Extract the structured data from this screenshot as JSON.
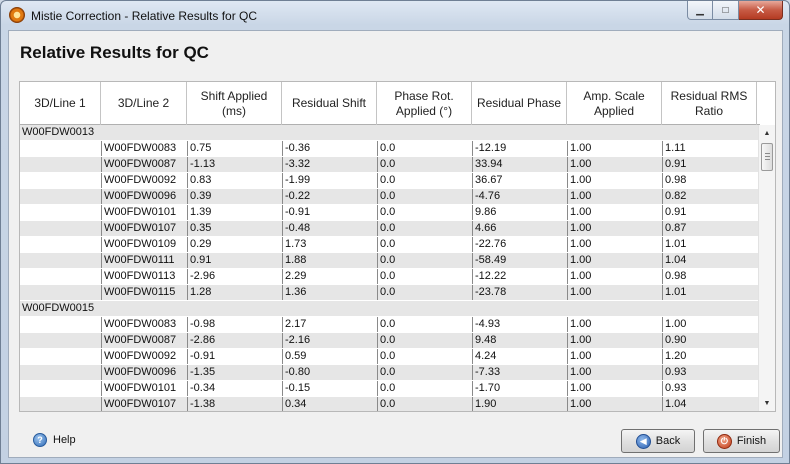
{
  "window": {
    "title": "Mistie Correction - Relative Results for QC",
    "minimize_glyph": "▁",
    "maximize_glyph": "□",
    "close_glyph": "✕"
  },
  "page": {
    "title": "Relative Results for QC"
  },
  "table": {
    "columns": [
      {
        "label": "3D/Line 1",
        "width": 81
      },
      {
        "label": "3D/Line 2",
        "width": 86
      },
      {
        "label": "Shift Applied (ms)",
        "width": 95
      },
      {
        "label": "Residual Shift",
        "width": 95
      },
      {
        "label": "Phase Rot. Applied (°)",
        "width": 95
      },
      {
        "label": "Residual Phase",
        "width": 95
      },
      {
        "label": "Amp. Scale Applied",
        "width": 95
      },
      {
        "label": "Residual RMS Ratio",
        "width": 95
      }
    ],
    "groups": [
      {
        "name": "W00FDW0013",
        "rows": [
          [
            "W00FDW0083",
            "0.75",
            "-0.36",
            "0.0",
            "-12.19",
            "1.00",
            "1.11"
          ],
          [
            "W00FDW0087",
            "-1.13",
            "-3.32",
            "0.0",
            "33.94",
            "1.00",
            "0.91"
          ],
          [
            "W00FDW0092",
            "0.83",
            "-1.99",
            "0.0",
            "36.67",
            "1.00",
            "0.98"
          ],
          [
            "W00FDW0096",
            "0.39",
            "-0.22",
            "0.0",
            "-4.76",
            "1.00",
            "0.82"
          ],
          [
            "W00FDW0101",
            "1.39",
            "-0.91",
            "0.0",
            "9.86",
            "1.00",
            "0.91"
          ],
          [
            "W00FDW0107",
            "0.35",
            "-0.48",
            "0.0",
            "4.66",
            "1.00",
            "0.87"
          ],
          [
            "W00FDW0109",
            "0.29",
            "1.73",
            "0.0",
            "-22.76",
            "1.00",
            "1.01"
          ],
          [
            "W00FDW0111",
            "0.91",
            "1.88",
            "0.0",
            "-58.49",
            "1.00",
            "1.04"
          ],
          [
            "W00FDW0113",
            "-2.96",
            "2.29",
            "0.0",
            "-12.22",
            "1.00",
            "0.98"
          ],
          [
            "W00FDW0115",
            "1.28",
            "1.36",
            "0.0",
            "-23.78",
            "1.00",
            "1.01"
          ]
        ]
      },
      {
        "name": "W00FDW0015",
        "rows": [
          [
            "W00FDW0083",
            "-0.98",
            "2.17",
            "0.0",
            "-4.93",
            "1.00",
            "1.00"
          ],
          [
            "W00FDW0087",
            "-2.86",
            "-2.16",
            "0.0",
            "9.48",
            "1.00",
            "0.90"
          ],
          [
            "W00FDW0092",
            "-0.91",
            "0.59",
            "0.0",
            "4.24",
            "1.00",
            "1.20"
          ],
          [
            "W00FDW0096",
            "-1.35",
            "-0.80",
            "0.0",
            "-7.33",
            "1.00",
            "0.93"
          ],
          [
            "W00FDW0101",
            "-0.34",
            "-0.15",
            "0.0",
            "-1.70",
            "1.00",
            "0.93"
          ],
          [
            "W00FDW0107",
            "-1.38",
            "0.34",
            "0.0",
            "1.90",
            "1.00",
            "1.04"
          ]
        ]
      }
    ],
    "scroll_up_glyph": "▲",
    "scroll_down_glyph": "▼"
  },
  "footer": {
    "help_label": "Help",
    "help_glyph": "?",
    "back_label": "Back",
    "back_glyph": "◀",
    "finish_label": "Finish",
    "finish_glyph": "⏻"
  },
  "icons": {
    "app": "app-logo-icon",
    "help": "help-icon",
    "back": "back-arrow-icon",
    "finish": "power-icon"
  }
}
